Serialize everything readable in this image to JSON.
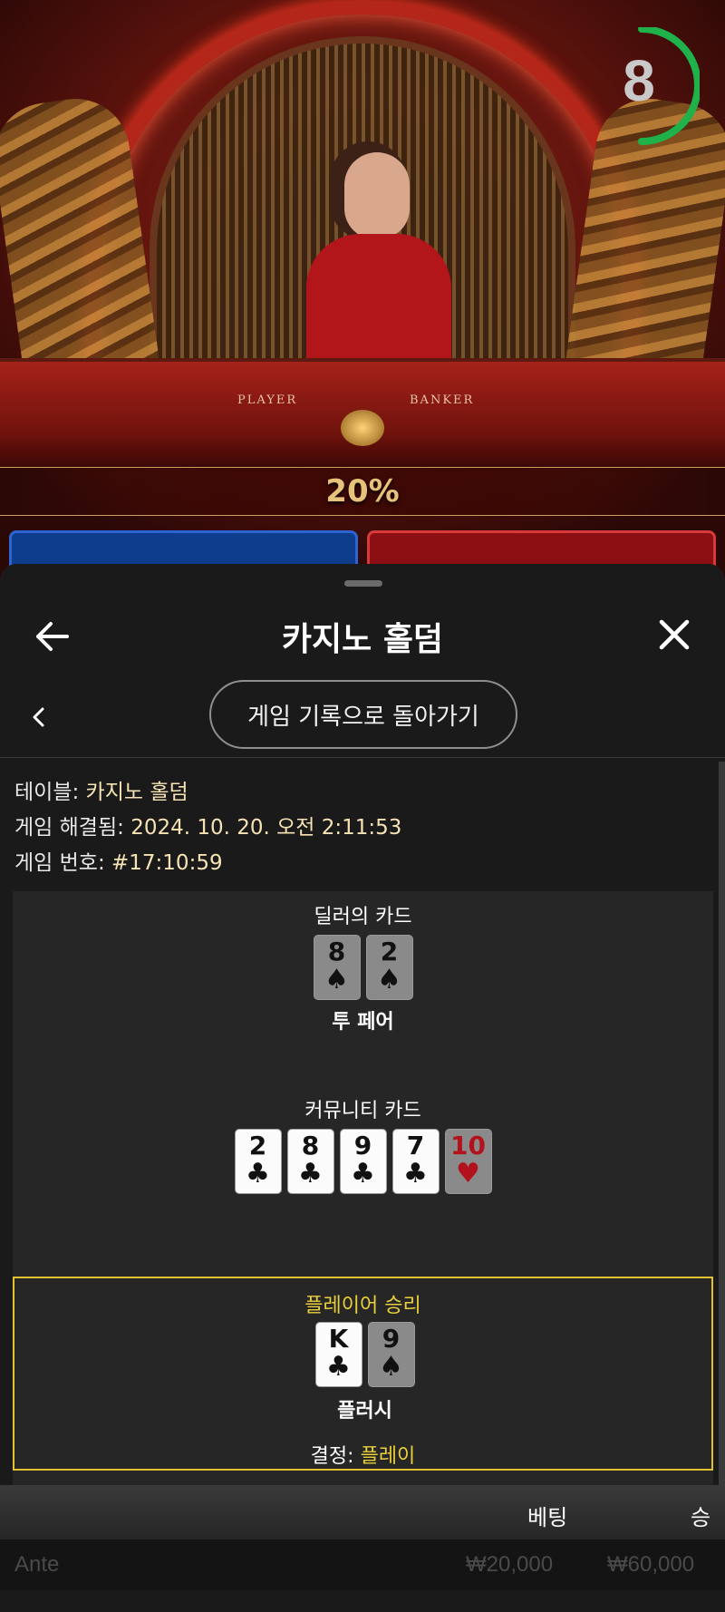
{
  "stream": {
    "timer_value": "8",
    "timer_color": "#1fb24a",
    "felt_labels": [
      "PLAYER",
      "BANKER"
    ],
    "multiplier_banner": "20%"
  },
  "sheet": {
    "title": "카지노 홀덤",
    "back_button_label": "게임 기록으로 돌아가기",
    "info": {
      "table_label": "테이블:",
      "table_value": "카지노 홀덤",
      "resolved_label": "게임 해결됨:",
      "resolved_value": "2024. 10. 20. 오전 2:11:53",
      "game_no_label": "게임 번호:",
      "game_no_value": "#17:10:59"
    },
    "dealer": {
      "title": "딜러의 카드",
      "cards": [
        {
          "rank": "8",
          "suit": "♠",
          "style": "grey"
        },
        {
          "rank": "2",
          "suit": "♠",
          "style": "grey"
        }
      ],
      "hand": "투 페어"
    },
    "community": {
      "title": "커뮤니티 카드",
      "cards": [
        {
          "rank": "2",
          "suit": "♣",
          "style": "white"
        },
        {
          "rank": "8",
          "suit": "♣",
          "style": "white"
        },
        {
          "rank": "9",
          "suit": "♣",
          "style": "white"
        },
        {
          "rank": "7",
          "suit": "♣",
          "style": "white"
        },
        {
          "rank": "10",
          "suit": "♥",
          "style": "grey-red"
        }
      ]
    },
    "player": {
      "title": "플레이어 승리",
      "cards": [
        {
          "rank": "K",
          "suit": "♣",
          "style": "white"
        },
        {
          "rank": "9",
          "suit": "♠",
          "style": "grey"
        }
      ],
      "hand": "플러시",
      "decision_label": "결정:",
      "decision_value": "플레이"
    },
    "bets_table": {
      "headers": [
        "베팅",
        "승"
      ],
      "rows": [
        {
          "name": "Ante",
          "bet": "₩20,000",
          "win": "₩60,000"
        }
      ]
    },
    "accent_color": "#e9cf3a"
  }
}
